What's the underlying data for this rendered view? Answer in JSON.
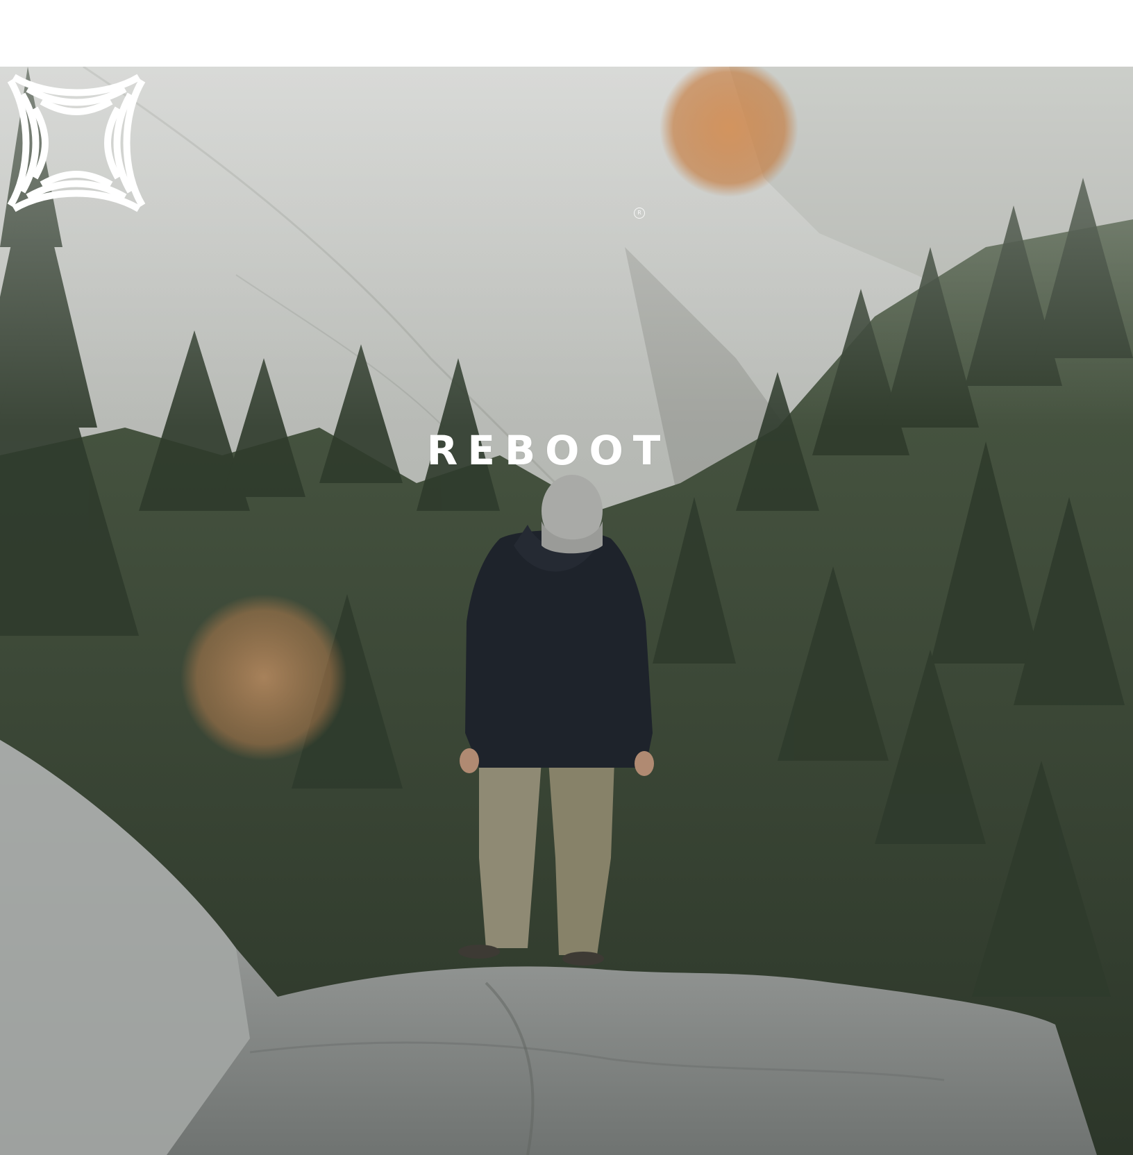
{
  "brand": {
    "name": "REBOOT",
    "logo_icon": "reboot-starburst-arcs-logo",
    "registered_mark": "R"
  },
  "scene": {
    "colors": {
      "sky_mist": "#c9cbc6",
      "granite": "#b4b6b1",
      "forest": "#3c4a37",
      "rock_foreground": "#8e9290",
      "jacket": "#1e232b",
      "pants": "#8f8a74",
      "beanie": "#a9aaa7",
      "flare": "#c8732f"
    }
  }
}
